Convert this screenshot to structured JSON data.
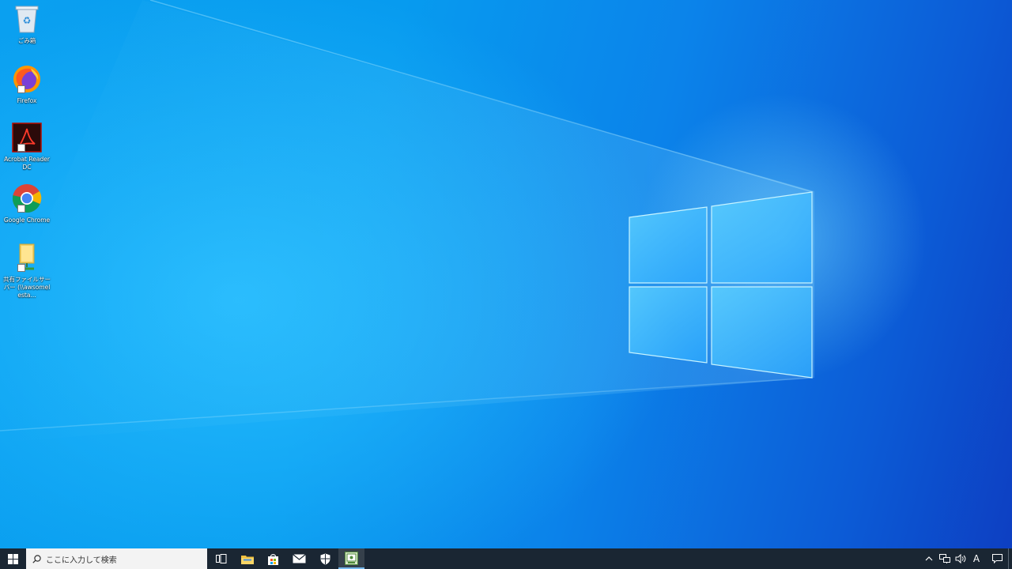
{
  "desktop": {
    "icons": [
      {
        "name": "recycle-bin",
        "label": "ごみ箱"
      },
      {
        "name": "firefox",
        "label": "Firefox"
      },
      {
        "name": "acrobat",
        "label": "Acrobat Reader DC"
      },
      {
        "name": "chrome",
        "label": "Google Chrome"
      },
      {
        "name": "file-server",
        "label": "共有ファイルサーバー (\\\\awsomelesta..."
      }
    ]
  },
  "taskbar": {
    "search_placeholder": "ここに入力して検索",
    "pinned": [
      "task-view",
      "file-explorer",
      "microsoft-store",
      "mail",
      "windows-security",
      "active-app"
    ],
    "tray": {
      "ime_label": "A"
    }
  },
  "colors": {
    "taskbar_bg": "#1a2633",
    "accent": "#76b9ed",
    "wallpaper_blue": "#0a9cf0"
  }
}
